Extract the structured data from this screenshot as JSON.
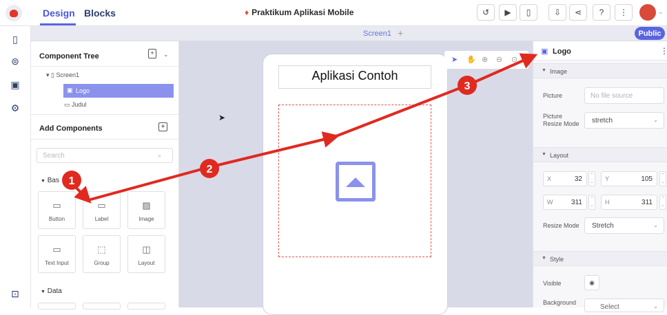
{
  "topbar": {
    "tabs": [
      {
        "label": "Design"
      },
      {
        "label": "Blocks"
      }
    ],
    "project_title": "Praktikum Aplikasi Mobile",
    "buttons": [
      "history-icon",
      "play-icon",
      "phone-preview-icon",
      "export-icon",
      "share-icon",
      "help-icon",
      "more-icon"
    ]
  },
  "left_rail": [
    "screen-icon",
    "database-icon",
    "file-icon",
    "settings-icon",
    "lock-icon"
  ],
  "screenbar": {
    "screen_tab": "Screen1",
    "add": "+",
    "public_label": "Public"
  },
  "component_tree": {
    "title": "Component Tree",
    "items": [
      {
        "label": "Screen1"
      },
      {
        "label": "Logo"
      },
      {
        "label": "Judul"
      }
    ]
  },
  "add_components": {
    "title": "Add Components",
    "search_placeholder": "Search",
    "basic_section": "Bas",
    "basic_tiles": [
      {
        "label": "Button",
        "icon": "▭"
      },
      {
        "label": "Label",
        "icon": "▭"
      },
      {
        "label": "Image",
        "icon": "▨"
      },
      {
        "label": "Text Input",
        "icon": "▭"
      },
      {
        "label": "Group",
        "icon": "⬚"
      },
      {
        "label": "Layout",
        "icon": "◫"
      }
    ],
    "data_section": "Data"
  },
  "canvas": {
    "app_title": "Aplikasi Contoh",
    "tools": [
      "select-icon",
      "hand-icon",
      "zoom-in-icon",
      "zoom-out-icon",
      "fit-icon"
    ]
  },
  "properties": {
    "component_name": "Logo",
    "image_section": "Image",
    "picture_label": "Picture",
    "picture_placeholder": "No file source",
    "resize_mode_label": "Picture Resize Mode",
    "resize_mode_value": "stretch",
    "layout_section": "Layout",
    "x": {
      "label": "X",
      "value": "32"
    },
    "y": {
      "label": "Y",
      "value": "105"
    },
    "w": {
      "label": "W",
      "value": "311"
    },
    "h": {
      "label": "H",
      "value": "311"
    },
    "layout_resize_label": "Resize Mode",
    "layout_resize_value": "Stretch",
    "style_section": "Style",
    "visible_label": "Visible",
    "background_label": "Background",
    "background_value": "Select"
  },
  "annotations": [
    {
      "number": "1"
    },
    {
      "number": "2"
    },
    {
      "number": "3"
    }
  ],
  "colors": {
    "accent": "#5a64e0",
    "annotation": "#e02a20",
    "canvas_bg": "#d8dae8"
  }
}
